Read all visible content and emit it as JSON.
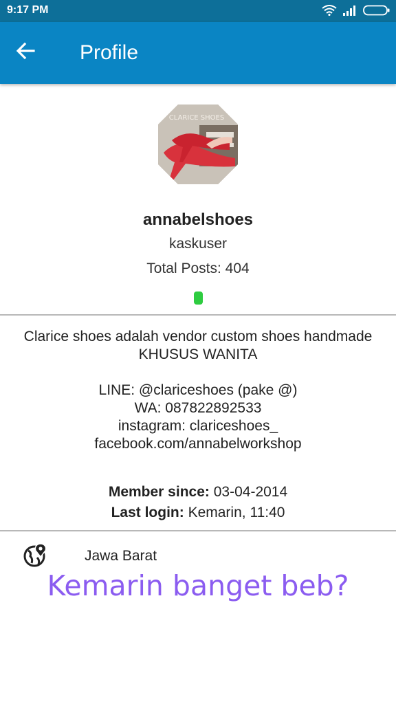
{
  "status_bar": {
    "time": "9:17 PM"
  },
  "app_bar": {
    "title": "Profile"
  },
  "profile": {
    "avatar_text": "CLARICE SHOES",
    "username": "annabelshoes",
    "user_title": "kaskuser",
    "total_posts": "Total Posts: 404",
    "online_color": "#2ecc40"
  },
  "bio": {
    "lines": [
      "Clarice shoes adalah vendor custom shoes handmade",
      "KHUSUS WANITA",
      "",
      "LINE: @clariceshoes (pake @)",
      "WA: 087822892533",
      "instagram: clariceshoes_",
      "facebook.com/annabelworkshop"
    ]
  },
  "meta": {
    "member_since_label": "Member since:",
    "member_since_value": "03-04-2014",
    "last_login_label": "Last login:",
    "last_login_value": "Kemarin, 11:40"
  },
  "location": {
    "icon": "globe-location-icon",
    "text": "Jawa Barat"
  },
  "overlay": {
    "text": "Kemarin banget beb?"
  },
  "colors": {
    "status_bar": "#0d6f99",
    "app_bar": "#0a85c4",
    "overlay": "#8b5cf0"
  }
}
